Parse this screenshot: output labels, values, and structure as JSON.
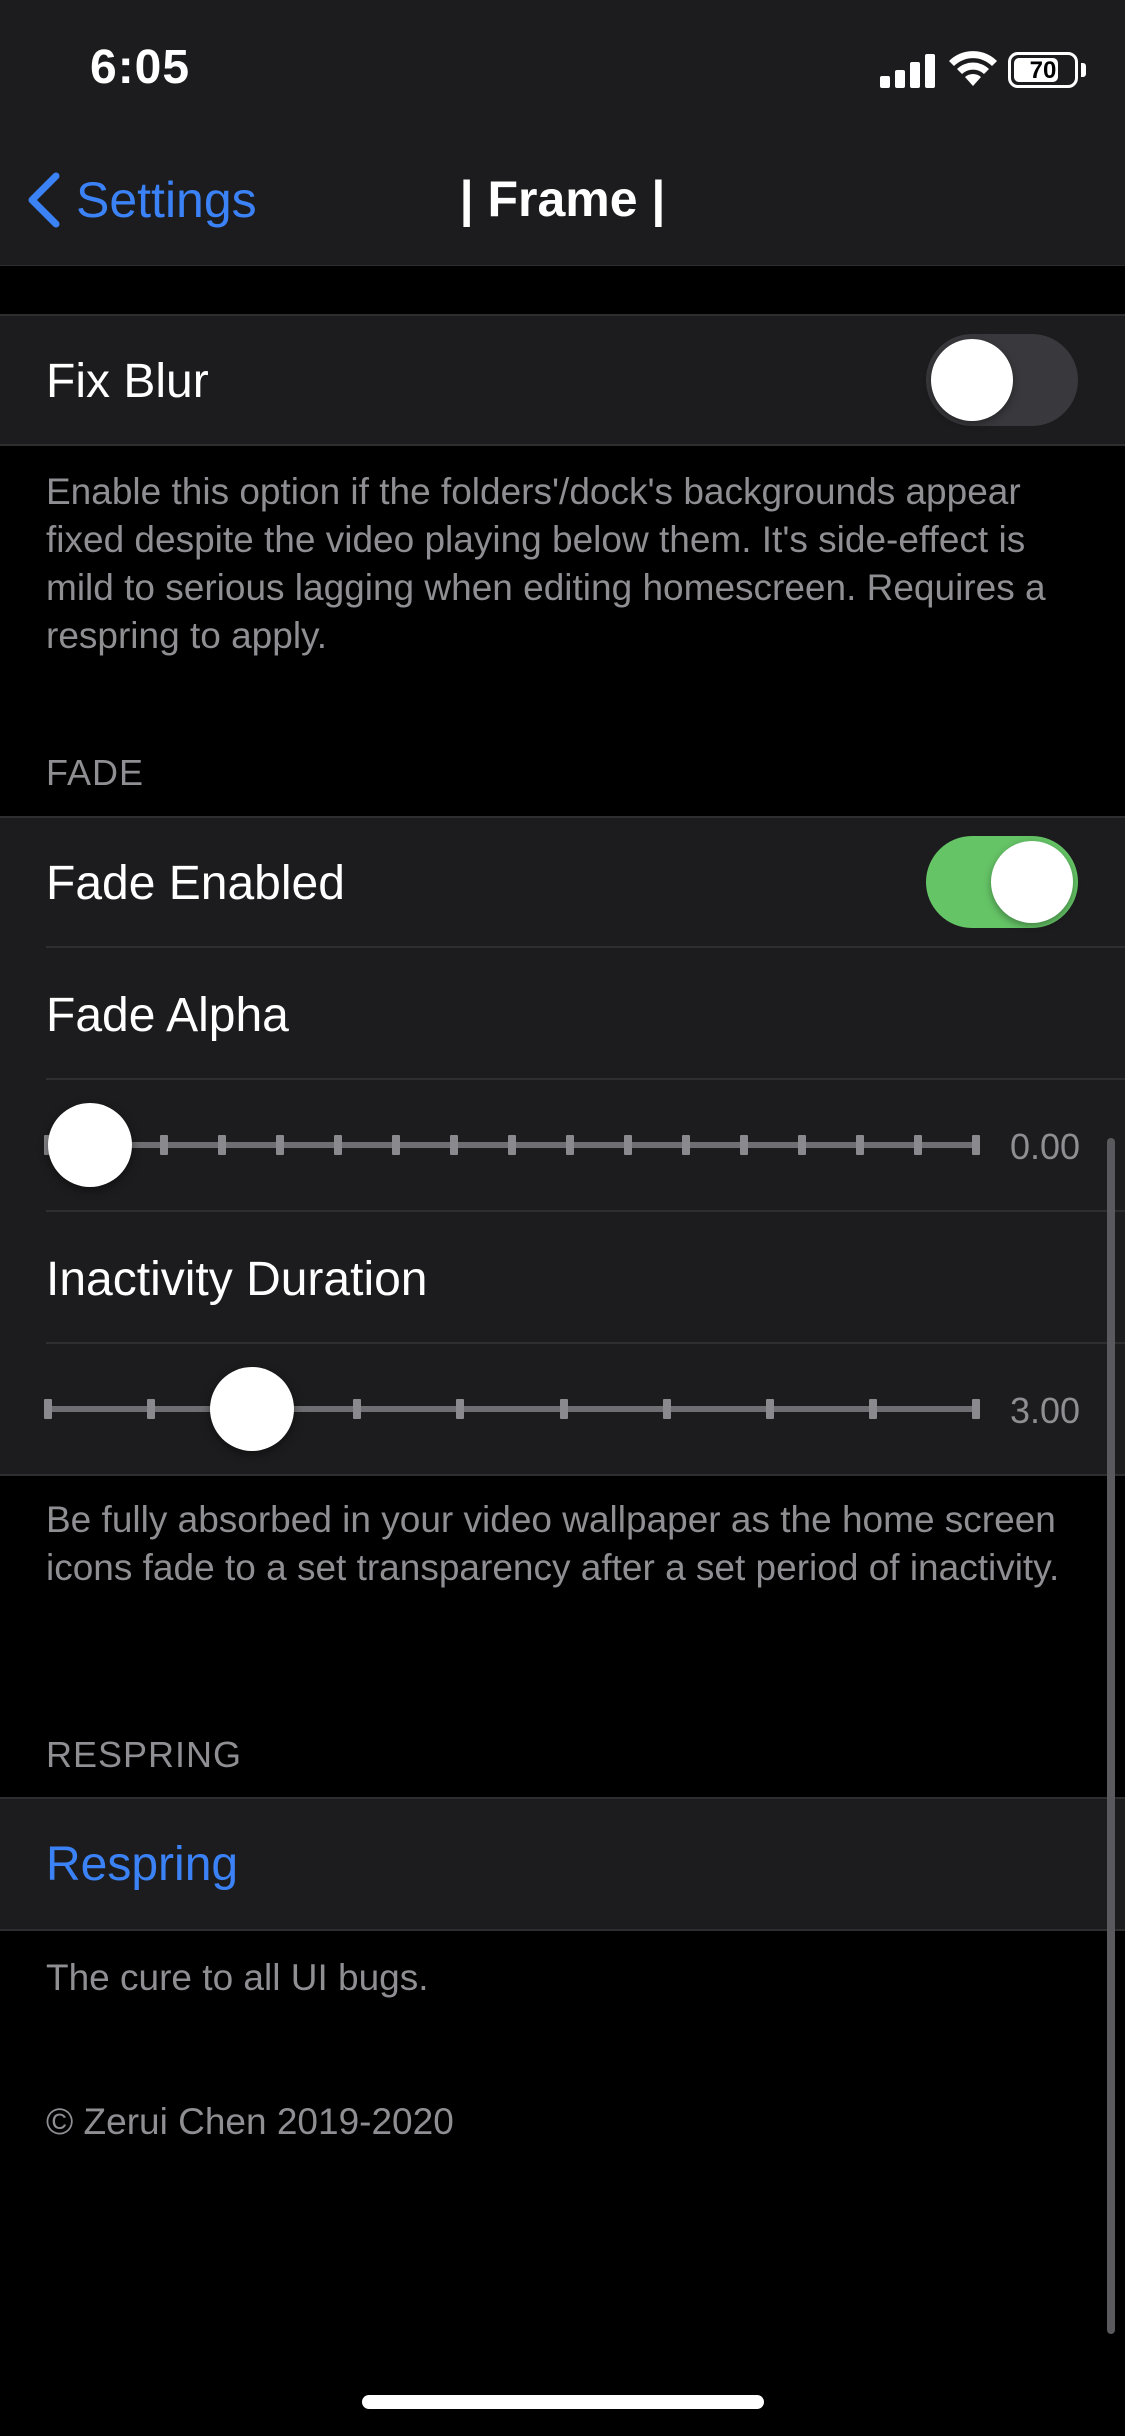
{
  "status_bar": {
    "time": "6:05",
    "battery_level": "70",
    "icons": [
      "cellular-signal-icon",
      "wifi-icon",
      "battery-icon"
    ]
  },
  "nav": {
    "back_label": "Settings",
    "title": "| Frame |",
    "accent_color": "#3b82f6"
  },
  "fix_blur": {
    "label": "Fix Blur",
    "enabled": false,
    "footer": "Enable this option if the folders'/dock's backgrounds appear fixed despite the video playing below them. It's side-effect is mild to serious lagging when editing homescreen. Requires a respring to apply."
  },
  "fade": {
    "header": "FADE",
    "fade_enabled": {
      "label": "Fade Enabled",
      "enabled": true
    },
    "fade_alpha": {
      "label": "Fade Alpha",
      "value": "0.00",
      "position_fraction": 0.0
    },
    "inactivity_duration": {
      "label": "Inactivity Duration",
      "value": "3.00",
      "position_fraction": 0.22
    },
    "footer": "Be fully absorbed in your video wallpaper as the home screen icons fade to a set transparency after a set period of inactivity."
  },
  "respring": {
    "header": "RESPRING",
    "button_label": "Respring",
    "footer": "The cure to all UI bugs."
  },
  "copyright": "© Zerui Chen 2019-2020",
  "colors": {
    "background": "#000000",
    "cell": "#1c1c1e",
    "toggle_on": "#65c466",
    "secondary_text": "#8e8e93"
  }
}
